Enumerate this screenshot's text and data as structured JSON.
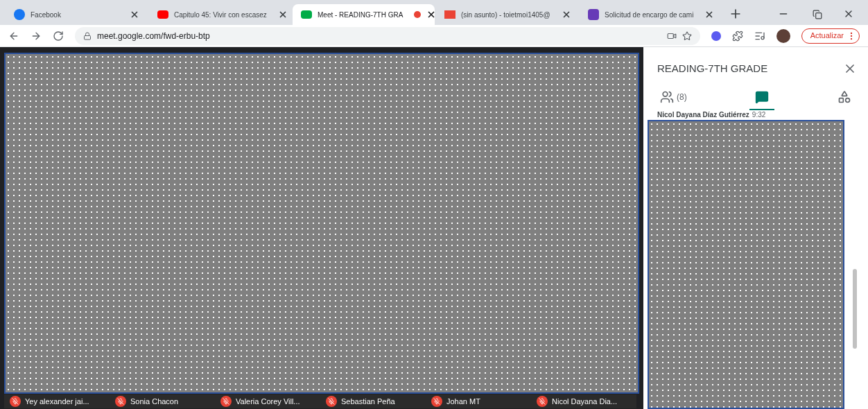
{
  "browser": {
    "tabs": [
      {
        "title": "Facebook",
        "selected": false,
        "recording": false
      },
      {
        "title": "Capitulo 45: Vivir con escasez",
        "selected": false,
        "recording": false
      },
      {
        "title": "Meet - READING-7TH GRA",
        "selected": true,
        "recording": true
      },
      {
        "title": "(sin asunto) - toietmoi1405@",
        "selected": false,
        "recording": false
      },
      {
        "title": "Solicitud de encargo de cami",
        "selected": false,
        "recording": false
      }
    ],
    "url": "meet.google.com/fwd-erbu-btp",
    "update_button": "Actualizar"
  },
  "participants": [
    {
      "name": "Yey alexander jai..."
    },
    {
      "name": "Sonia Chacon"
    },
    {
      "name": "Valeria Corey Vill..."
    },
    {
      "name": "Sebastian Peña"
    },
    {
      "name": "Johan MT"
    },
    {
      "name": "Nicol Dayana Dia..."
    }
  ],
  "panel": {
    "title": "READING-7TH GRADE",
    "tabs": [
      {
        "kind": "people",
        "count": "(8)",
        "selected": false
      },
      {
        "kind": "chat",
        "selected": true
      },
      {
        "kind": "activities",
        "selected": false
      }
    ],
    "chat_sender": "Nicol Dayana Díaz Gutiérrez",
    "chat_time": "9:32"
  }
}
